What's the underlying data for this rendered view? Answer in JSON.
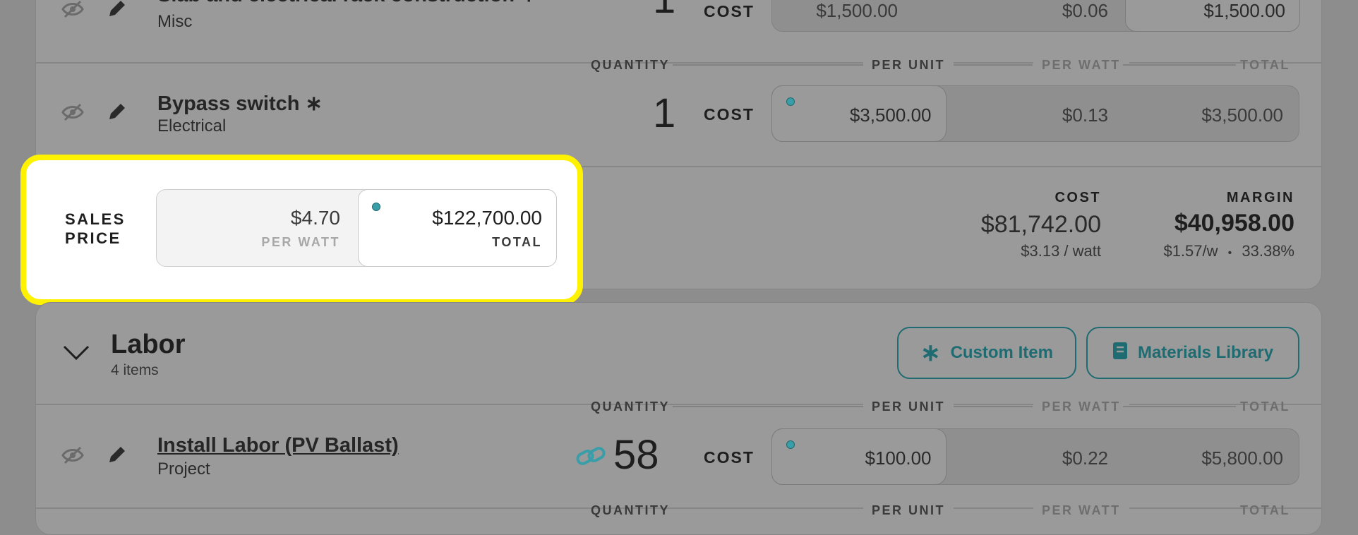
{
  "colors": {
    "accent": "#1f6b72",
    "highlight": "#fff200",
    "dot": "#3a9ea8"
  },
  "headers": {
    "quantity": "QUANTITY",
    "per_unit": "PER UNIT",
    "per_watt": "PER WATT",
    "total": "TOTAL",
    "cost": "COST"
  },
  "items": [
    {
      "title": "Slab and electrical rack construction ∗",
      "category": "Misc",
      "quantity": "1",
      "per_unit": "$1,500.00",
      "per_watt": "$0.06",
      "total": "$1,500.00"
    },
    {
      "title": "Bypass switch ∗",
      "category": "Electrical",
      "quantity": "1",
      "per_unit": "$3,500.00",
      "per_watt": "$0.13",
      "total": "$3,500.00"
    }
  ],
  "sales_price": {
    "label_line1": "SALES",
    "label_line2": "PRICE",
    "per_watt_value": "$4.70",
    "per_watt_label": "PER WATT",
    "total_value": "$122,700.00",
    "total_label": "TOTAL"
  },
  "summary": {
    "cost_label": "COST",
    "cost_value": "$81,742.00",
    "cost_per_watt": "$3.13 / watt",
    "margin_label": "MARGIN",
    "margin_value": "$40,958.00",
    "margin_per_watt": "$1.57/w",
    "margin_sep": "•",
    "margin_percent": "33.38%"
  },
  "labor": {
    "title": "Labor",
    "count": "4 items",
    "custom_item_button": "Custom Item",
    "materials_library_button": "Materials Library",
    "item": {
      "title": "Install Labor (PV Ballast)",
      "category": "Project",
      "quantity": "58",
      "per_unit": "$100.00",
      "per_watt": "$0.22",
      "total": "$5,800.00"
    }
  }
}
